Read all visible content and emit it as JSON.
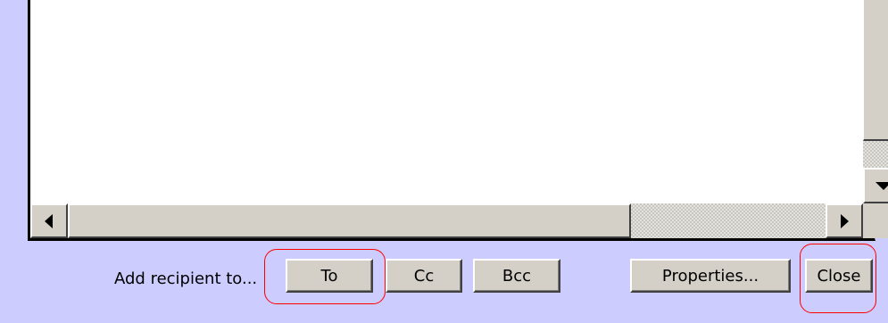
{
  "dialog": {
    "add_recipient_label": "Add recipient to...",
    "buttons": {
      "to": "To",
      "cc": "Cc",
      "bcc": "Bcc",
      "properties": "Properties...",
      "close": "Close"
    }
  },
  "colors": {
    "dialog_background": "#ccccff",
    "button_face": "#d4d0c8",
    "annotation": "#ff0000"
  },
  "icons": {
    "scroll_down": "triangle-down-icon",
    "scroll_left": "triangle-left-icon",
    "scroll_right": "triangle-right-icon"
  }
}
